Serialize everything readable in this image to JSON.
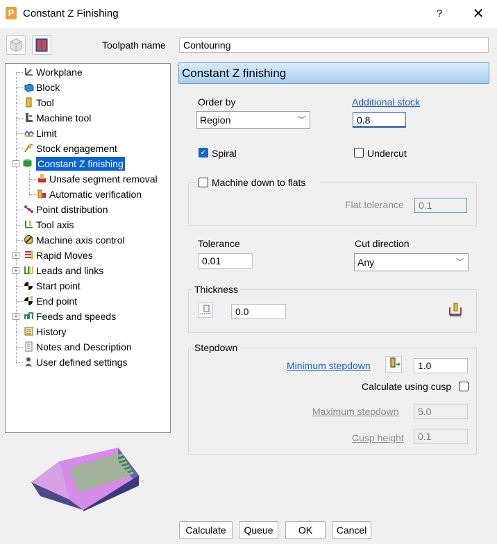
{
  "window": {
    "title": "Constant Z Finishing",
    "app_icon": "P",
    "help": "?",
    "close": "✕"
  },
  "toolbar": {
    "icon1": "cube-icon",
    "icon2": "preview-icon"
  },
  "toolpath_name": {
    "label": "Toolpath name",
    "value": "Contouring"
  },
  "tree": {
    "items": [
      {
        "label": "Workplane",
        "icon": "workplane-icon"
      },
      {
        "label": "Block",
        "icon": "block-icon"
      },
      {
        "label": "Tool",
        "icon": "tool-icon"
      },
      {
        "label": "Machine tool",
        "icon": "machine-tool-icon"
      },
      {
        "label": "Limit",
        "icon": "limit-icon"
      },
      {
        "label": "Stock engagement",
        "icon": "stock-engagement-icon"
      },
      {
        "label": "Constant Z finishing",
        "icon": "constant-z-icon",
        "selected": true
      },
      {
        "label": "Unsafe segment removal",
        "icon": "unsafe-segment-icon"
      },
      {
        "label": "Automatic verification",
        "icon": "verification-icon"
      },
      {
        "label": "Point distribution",
        "icon": "point-distribution-icon"
      },
      {
        "label": "Tool axis",
        "icon": "tool-axis-icon"
      },
      {
        "label": "Machine axis control",
        "icon": "machine-axis-icon"
      },
      {
        "label": "Rapid Moves",
        "icon": "rapid-moves-icon"
      },
      {
        "label": "Leads and links",
        "icon": "leads-links-icon"
      },
      {
        "label": "Start point",
        "icon": "start-point-icon"
      },
      {
        "label": "End point",
        "icon": "end-point-icon"
      },
      {
        "label": "Feeds and speeds",
        "icon": "feeds-speeds-icon"
      },
      {
        "label": "History",
        "icon": "history-icon"
      },
      {
        "label": "Notes and Description",
        "icon": "notes-icon"
      },
      {
        "label": "User defined settings",
        "icon": "user-settings-icon"
      }
    ]
  },
  "panel": {
    "header": "Constant Z finishing",
    "order_by": {
      "label": "Order by",
      "value": "Region"
    },
    "additional_stock": {
      "label": "Additional stock",
      "value": "0.8"
    },
    "spiral": {
      "label": "Spiral",
      "checked": true
    },
    "undercut": {
      "label": "Undercut",
      "checked": false
    },
    "machine_down": {
      "label": "Machine down to flats",
      "checked": false
    },
    "flat_tolerance": {
      "label": "Flat tolerance",
      "value": "0.1"
    },
    "tolerance": {
      "label": "Tolerance",
      "value": "0.01"
    },
    "cut_direction": {
      "label": "Cut direction",
      "value": "Any"
    },
    "thickness": {
      "label": "Thickness",
      "value": "0.0"
    },
    "stepdown": {
      "label": "Stepdown",
      "minimum_label": "Minimum stepdown",
      "minimum_value": "1.0",
      "cusp_label": "Calculate using cusp",
      "cusp_checked": false,
      "maximum_label": "Maximum stepdown",
      "maximum_value": "5.0",
      "cusp_height_label": "Cusp height",
      "cusp_height_value": "0.1"
    }
  },
  "buttons": {
    "calculate": "Calculate",
    "queue": "Queue",
    "ok": "OK",
    "cancel": "Cancel"
  },
  "colors": {
    "accent": "#0a63d4",
    "header_bg": "#a7cff0",
    "link": "#1a5fc8"
  }
}
